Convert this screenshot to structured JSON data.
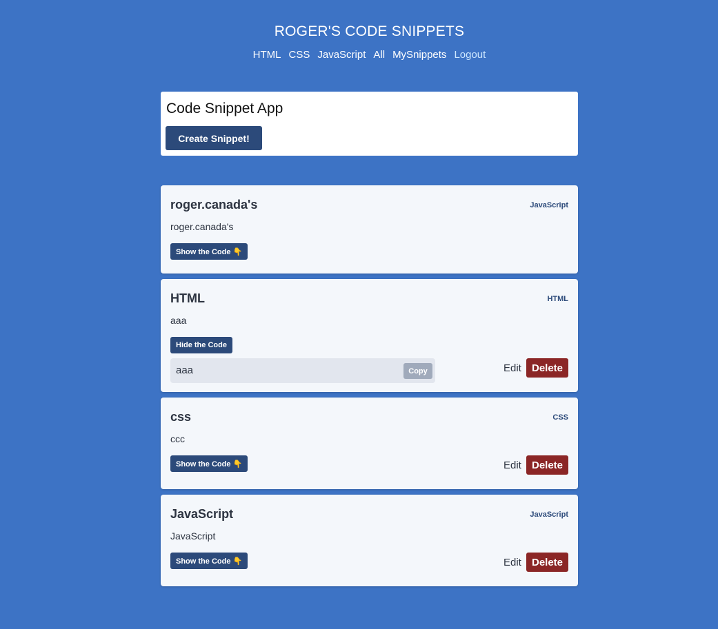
{
  "header": {
    "title": "ROGER'S CODE SNIPPETS",
    "nav": [
      "HTML",
      "CSS",
      "JavaScript",
      "All",
      "MySnippets",
      "Logout"
    ]
  },
  "app": {
    "title": "Code Snippet App",
    "create_label": "Create Snippet!"
  },
  "snippets": [
    {
      "title": "roger.canada's",
      "language": "JavaScript",
      "description": "roger.canada's",
      "toggle_label": "Show the Code 👇"
    },
    {
      "title": "HTML",
      "language": "HTML",
      "description": "aaa",
      "toggle_label": "Hide the Code",
      "code": "aaa",
      "copy_label": "Copy",
      "edit_label": "Edit",
      "delete_label": "Delete"
    },
    {
      "title": "css",
      "language": "CSS",
      "description": "ccc",
      "toggle_label": "Show the Code 👇",
      "edit_label": "Edit",
      "delete_label": "Delete"
    },
    {
      "title": "JavaScript",
      "language": "JavaScript",
      "description": "JavaScript",
      "toggle_label": "Show the Code 👇",
      "edit_label": "Edit",
      "delete_label": "Delete"
    }
  ],
  "colors": {
    "page_background": "#3d73c5",
    "primary_button": "#2c4a7a",
    "delete_button": "#8b2626",
    "card_background": "#f4f7fb"
  }
}
